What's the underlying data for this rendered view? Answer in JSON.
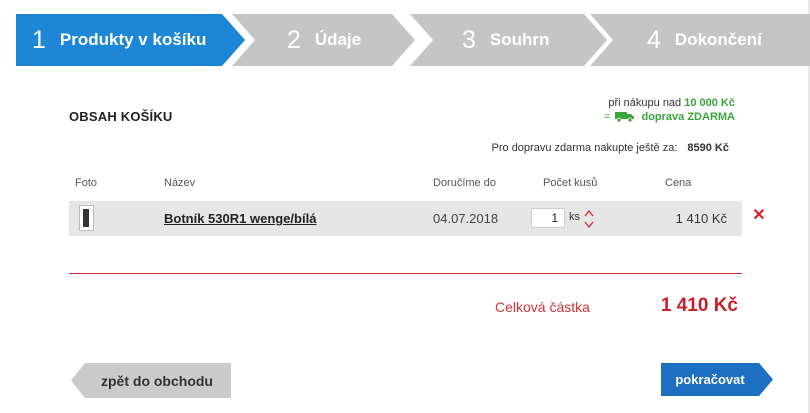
{
  "steps": [
    {
      "number": "1",
      "label": "Produkty v košíku"
    },
    {
      "number": "2",
      "label": "Údaje"
    },
    {
      "number": "3",
      "label": "Souhrn"
    },
    {
      "number": "4",
      "label": "Dokončení"
    }
  ],
  "cart": {
    "title": "OBSAH KOŠÍKU",
    "free_shipping_prefix": "při nákupu nad",
    "free_shipping_amount": "10 000 Kč",
    "free_shipping_eq": "=",
    "free_shipping_label": "doprava ZDARMA",
    "remaining_text": "Pro dopravu zdarma nakupte ještě za:",
    "remaining_amount": "8590 Kč",
    "columns": {
      "photo": "Foto",
      "name": "Název",
      "delivery": "Doručíme do",
      "quantity": "Počet kusů",
      "price": "Cena"
    },
    "items": [
      {
        "name": "Botník 530R1 wenge/bílá",
        "delivery": "04.07.2018",
        "quantity": "1",
        "unit": "ks",
        "price": "1 410 Kč"
      }
    ],
    "total_label": "Celková částka",
    "total_value": "1 410 Kč"
  },
  "buttons": {
    "back": "zpět do obchodu",
    "continue": "pokračovat"
  },
  "colors": {
    "active_step": "#1d86d6",
    "inactive_step": "#c5c5c5",
    "accent_red": "#c91e2a",
    "free_green": "#3aa33a",
    "continue_button": "#1d6fc2"
  },
  "icons": {
    "truck": "truck-icon",
    "remove": "close-icon",
    "quantity": "up-down-arrows-icon"
  }
}
